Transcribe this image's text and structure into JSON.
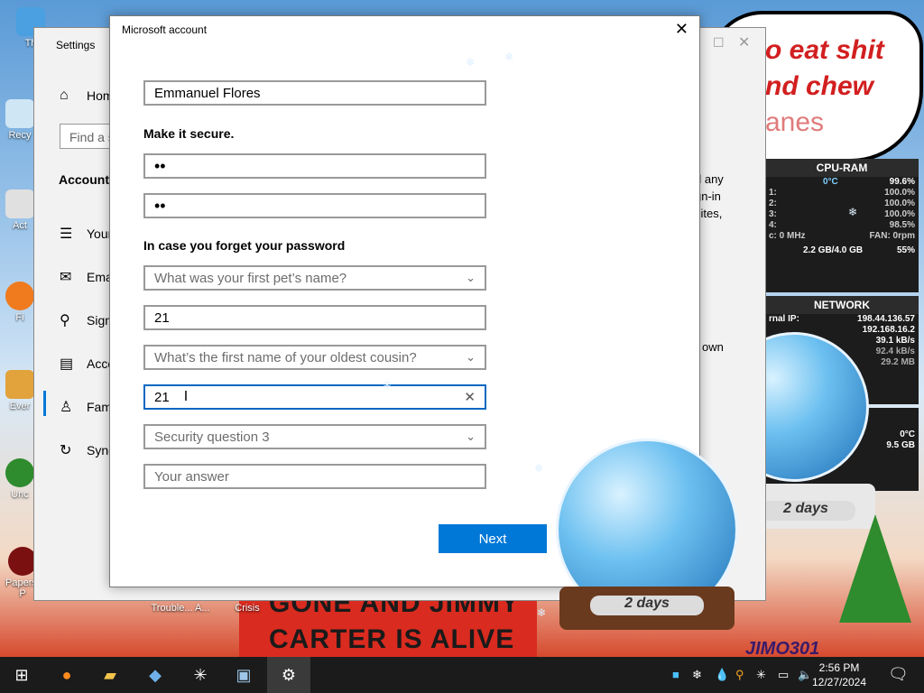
{
  "desktop": {
    "icons": [
      {
        "label": "Th"
      },
      {
        "label": "Recy"
      },
      {
        "label": "Act"
      },
      {
        "label": "Fi"
      },
      {
        "label": "Ever"
      },
      {
        "label": "Unc"
      },
      {
        "label": "Papers, P"
      }
    ],
    "bubble_lines": [
      "o eat shit",
      "nd chew",
      "anes"
    ],
    "meme_lines": [
      "GONE AND JIMMY",
      "CARTER IS ALIVE"
    ],
    "file_labels": [
      "Trouble... A...",
      "Crisis"
    ],
    "corner_text": "JIMO301"
  },
  "gadgets": {
    "cpu": {
      "title": "CPU-RAM",
      "temp": "0°C",
      "total": "99.6%",
      "cores": [
        {
          "k": "1:",
          "v": "100.0%"
        },
        {
          "k": "2:",
          "v": "100.0%"
        },
        {
          "k": "3:",
          "v": "100.0%"
        },
        {
          "k": "4:",
          "v": "98.5%"
        }
      ],
      "freq": "c: 0 MHz",
      "fan": "FAN: 0rpm",
      "ram": "2.2 GB/4.0 GB",
      "ram_pct": "55%"
    },
    "network": {
      "title": "NETWORK",
      "ext_label": "rnal IP:",
      "ext_ip": "198.44.136.57",
      "int_ip": "192.168.16.2",
      "up": "39.1 kB/s",
      "down": "92.4 kB/s",
      "total": "29.2 MB"
    },
    "extra": {
      "temp": "0°C",
      "mem": "9.5 GB"
    },
    "globe_labels": [
      "2 days",
      "2 days"
    ]
  },
  "settings": {
    "title": "Settings",
    "home": "Hom",
    "search_placeholder": "Find a s",
    "section": "Accounts",
    "nav": [
      {
        "label": "Your",
        "icon": "user-info-icon"
      },
      {
        "label": "Ema",
        "icon": "mail-icon"
      },
      {
        "label": "Sign",
        "icon": "key-icon"
      },
      {
        "label": "Acce",
        "icon": "briefcase-icon"
      },
      {
        "label": "Fam",
        "icon": "family-icon"
      },
      {
        "label": "Sync",
        "icon": "sync-icon"
      }
    ],
    "right_text": [
      "d any",
      "gn-in",
      "sites,",
      "eir own"
    ]
  },
  "dialog": {
    "title": "Microsoft account",
    "name_value": "Emmanuel Flores",
    "secure_heading": "Make it secure.",
    "password_mask": "••",
    "confirm_mask": "••",
    "forgot_heading": "In case you forget your password",
    "q1": "What was your first pet’s name?",
    "a1": "21",
    "q2": "What’s the first name of your oldest cousin?",
    "a2": "21",
    "q3": "Security question 3",
    "a3_placeholder": "Your answer",
    "next_label": "Next"
  },
  "taskbar": {
    "time": "2:56 PM",
    "date": "12/27/2024"
  },
  "colors": {
    "accent": "#0078d7",
    "focus_border": "#0067c0",
    "taskbar": "#1b1b1b",
    "meme_red": "#d92b1f"
  }
}
